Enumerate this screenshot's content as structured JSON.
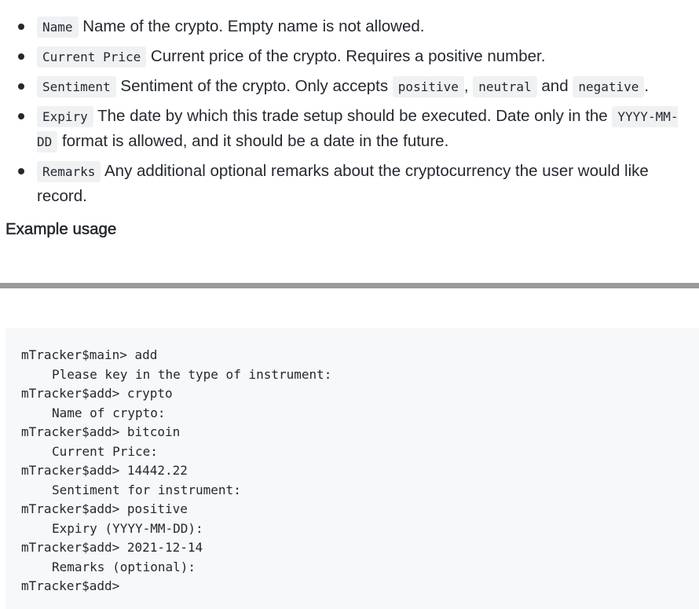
{
  "fields": [
    {
      "code": "Name",
      "parts": [
        {
          "type": "text",
          "value": " Name of the crypto. Empty name is not allowed."
        }
      ]
    },
    {
      "code": "Current Price",
      "parts": [
        {
          "type": "text",
          "value": " Current price of the crypto. Requires a positive number."
        }
      ]
    },
    {
      "code": "Sentiment",
      "parts": [
        {
          "type": "text",
          "value": " Sentiment of the crypto. Only accepts "
        },
        {
          "type": "code",
          "value": "positive"
        },
        {
          "type": "text",
          "value": ", "
        },
        {
          "type": "code",
          "value": "neutral"
        },
        {
          "type": "text",
          "value": " and "
        },
        {
          "type": "code",
          "value": "negative"
        },
        {
          "type": "text",
          "value": "."
        }
      ]
    },
    {
      "code": "Expiry",
      "parts": [
        {
          "type": "text",
          "value": " The date by which this trade setup should be executed. Date only in the "
        },
        {
          "type": "code",
          "value": "YYYY-MM-DD"
        },
        {
          "type": "text",
          "value": " format is allowed, and it should be a date in the future."
        }
      ]
    },
    {
      "code": "Remarks",
      "parts": [
        {
          "type": "text",
          "value": " Any additional optional remarks about the cryptocurrency the user would like record."
        }
      ]
    }
  ],
  "heading": "Example usage",
  "terminal_lines": [
    {
      "text": "mTracker$main> add",
      "indent": false
    },
    {
      "text": "Please key in the type of instrument:",
      "indent": true
    },
    {
      "text": "mTracker$add> crypto",
      "indent": false
    },
    {
      "text": "Name of crypto:",
      "indent": true
    },
    {
      "text": "mTracker$add> bitcoin",
      "indent": false
    },
    {
      "text": "Current Price:",
      "indent": true
    },
    {
      "text": "mTracker$add> 14442.22",
      "indent": false
    },
    {
      "text": "Sentiment for instrument:",
      "indent": true
    },
    {
      "text": "mTracker$add> positive",
      "indent": false
    },
    {
      "text": "Expiry (YYYY-MM-DD):",
      "indent": true
    },
    {
      "text": "mTracker$add> 2021-12-14",
      "indent": false
    },
    {
      "text": "Remarks (optional):",
      "indent": true
    },
    {
      "text": "mTracker$add>",
      "indent": false
    }
  ]
}
